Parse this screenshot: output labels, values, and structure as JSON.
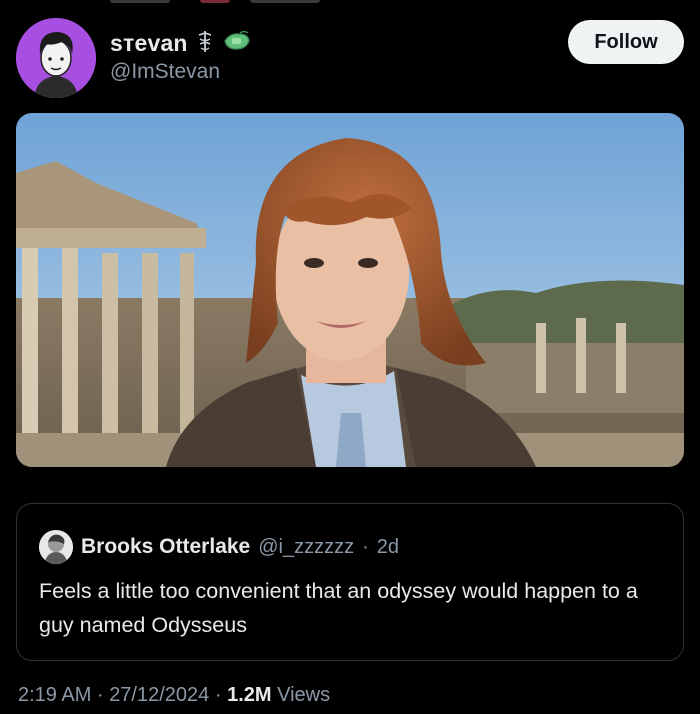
{
  "author": {
    "display_name": "sтevan",
    "handle": "@ImStevan",
    "badge_emojis": [
      "staff-of-hermes",
      "cash-bundle"
    ]
  },
  "actions": {
    "follow_label": "Follow"
  },
  "media": {
    "icon": "photo"
  },
  "quoted_post": {
    "author_name": "Brooks Otterlake",
    "author_handle": "@i_zzzzzz",
    "separator": "·",
    "age": "2d",
    "text": "Feels a little too convenient that an odyssey would happen to a guy named Odysseus"
  },
  "post_meta": {
    "time": "2:19 AM",
    "date": "27/12/2024",
    "separator": "·",
    "views_count": "1.2M",
    "views_label": "Views"
  },
  "colors": {
    "background": "#000000",
    "text_primary": "#e7e9ea",
    "text_secondary": "#8b98a5",
    "border": "#2f3336",
    "avatar_bg": "#a64fe0",
    "follow_bg": "#eff3f4"
  }
}
